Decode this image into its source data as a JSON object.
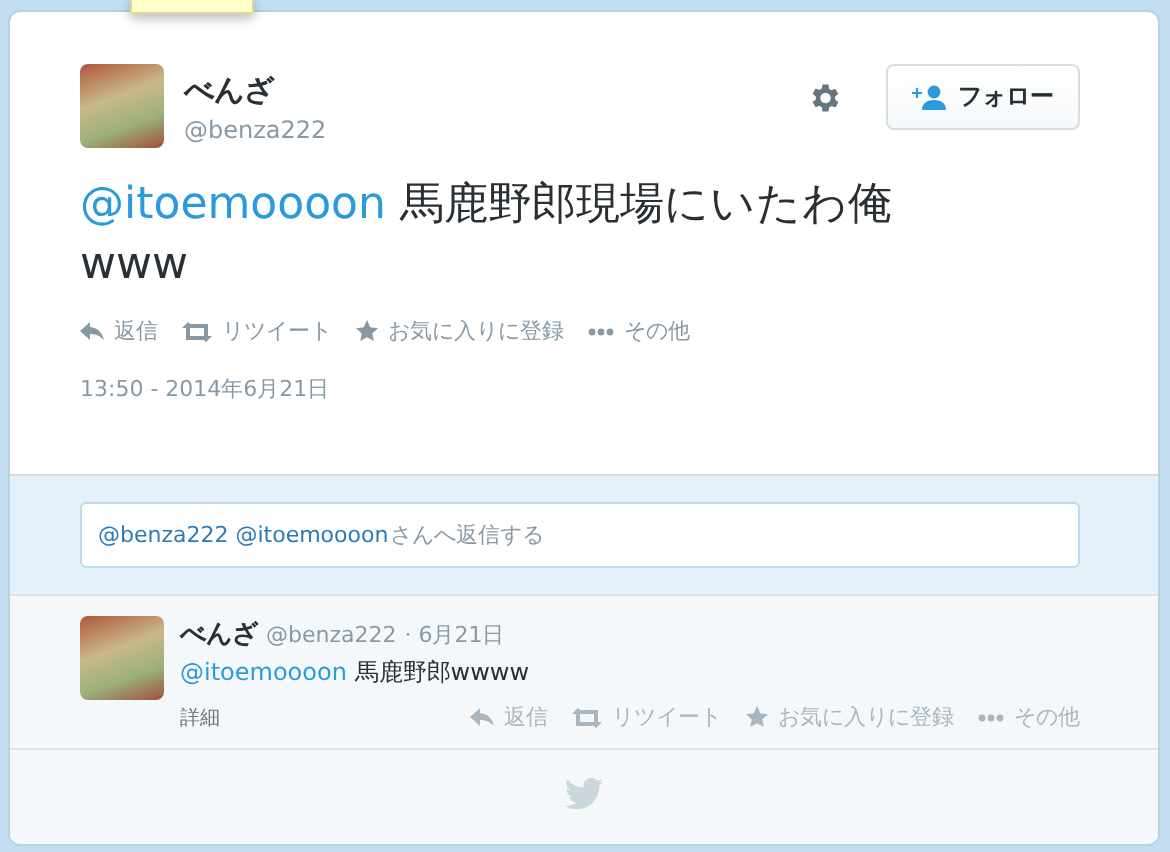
{
  "tweet": {
    "name": "べんざ",
    "handle": "@benza222",
    "follow_label": "フォロー",
    "mention": "@itoemoooon",
    "text": "馬鹿野郎現場にいたわ俺www",
    "actions": [
      {
        "kind": "reply",
        "label": "返信"
      },
      {
        "kind": "retweet",
        "label": "リツイート"
      },
      {
        "kind": "favorite",
        "label": "お気に入りに登録"
      },
      {
        "kind": "more",
        "label": "その他"
      }
    ],
    "timestamp": "13:50 - 2014年6月21日"
  },
  "reply_box": {
    "mentions": "@benza222 @itoemoooon",
    "placeholder": "さんへ返信する"
  },
  "replies": [
    {
      "name": "べんざ",
      "handle": "@benza222",
      "date": "· 6月21日",
      "mention": "@itoemoooon",
      "text": "馬鹿野郎wwww",
      "details": "詳細",
      "actions": [
        {
          "kind": "reply",
          "label": "返信"
        },
        {
          "kind": "retweet",
          "label": "リツイート"
        },
        {
          "kind": "favorite",
          "label": "お気に入りに登録"
        },
        {
          "kind": "more",
          "label": "その他"
        }
      ]
    }
  ]
}
